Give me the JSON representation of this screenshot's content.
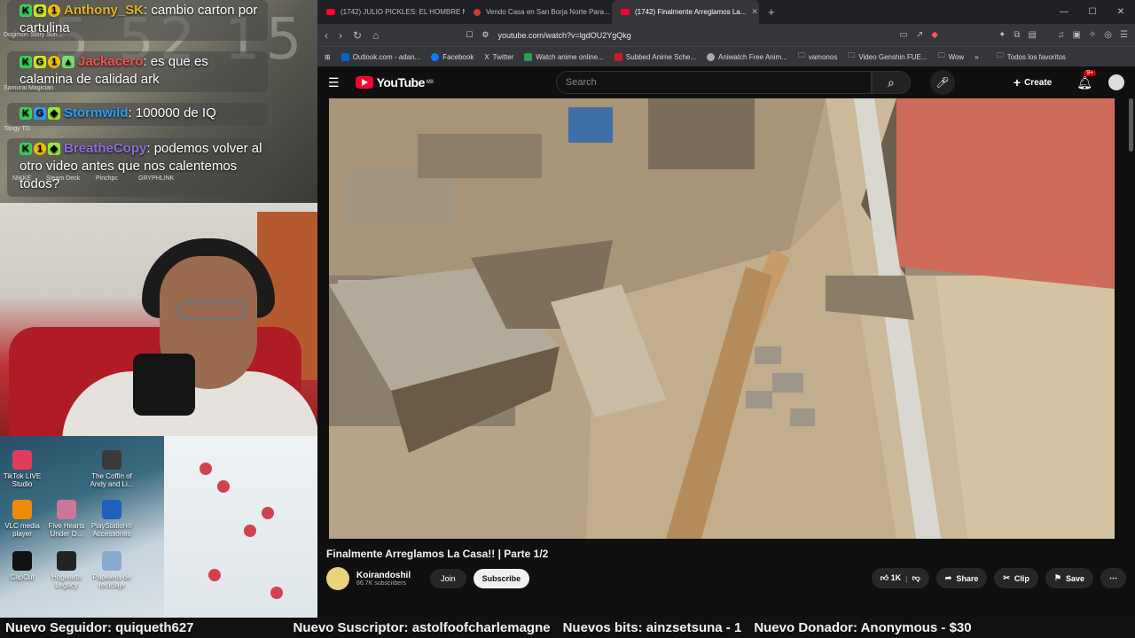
{
  "chat": {
    "clock": "5 52 15",
    "messages": [
      {
        "user": "Anthony_SK",
        "text": ": cambio carton por cartulina",
        "user_color": "#e0b321"
      },
      {
        "user": "Jackacero",
        "text": ": es que es calamina de calidad ark",
        "user_color": "#ff4d4d"
      },
      {
        "user": "Stormwild",
        "text": ": 100000 de IQ",
        "user_color": "#2a9df4"
      },
      {
        "user": "BreatheCopy",
        "text": ": podemos volver al otro video antes que nos calentemos todos?",
        "user_color": "#8f6dde"
      }
    ],
    "sub_labels": [
      "Dogimon Story Sun...",
      "Samurai Magician",
      "Tangy TD",
      "NIKKE",
      "Steam Deck",
      "Pinchpc",
      "GRYPHLINK"
    ]
  },
  "desktop_icons": [
    {
      "label": "TikTok LIVE Studio",
      "icon": "tiktok-live-icon",
      "color": "#e23b5b"
    },
    {
      "label": "The Coffin of Andy and Li...",
      "icon": "coffin-game-icon",
      "color": "#3a3a3a"
    },
    {
      "label": "VLC media player",
      "icon": "vlc-icon",
      "color": "#f08a00"
    },
    {
      "label": "Five Hearts Under O...",
      "icon": "five-hearts-icon",
      "color": "#cc7799"
    },
    {
      "label": "PlayStation® Accessories",
      "icon": "playstation-icon",
      "color": "#1f5fbf"
    },
    {
      "label": "CapCut",
      "icon": "capcut-icon",
      "color": "#111111"
    },
    {
      "label": "Hogwarts Legacy",
      "icon": "hogwarts-icon",
      "color": "#222222"
    },
    {
      "label": "Papelera de reciclaje",
      "icon": "recycle-bin-icon",
      "color": "#88aacc"
    }
  ],
  "browser": {
    "tabs": [
      {
        "title": "(1742) JULIO PICKLES: EL HOMBRE M...",
        "active": false
      },
      {
        "title": "Vendo Casa en San Borja Norte Para...",
        "active": false
      },
      {
        "title": "(1742) Finalmente Arreglamos La...",
        "active": true
      }
    ],
    "new_tab": "+",
    "url": "youtube.com/watch?v=lgdOU2YgQkg",
    "bookmarks": [
      {
        "label": "Outlook.com - adan...",
        "color": "#0a64c8"
      },
      {
        "label": "Facebook",
        "color": "#1877f2"
      },
      {
        "label": "Twitter",
        "color": "#222222"
      },
      {
        "label": "Watch anime online...",
        "color": "#2e9e4f"
      },
      {
        "label": "Subbed Anime Sche...",
        "color": "#c81e2a"
      },
      {
        "label": "Aniwatch Free Anim...",
        "color": "#aaaaaa"
      },
      {
        "label": "vamonos",
        "color": "#cccccc"
      },
      {
        "label": "Video Genshin FUE...",
        "color": "#cccccc"
      },
      {
        "label": "Wow",
        "color": "#cccccc"
      }
    ],
    "bookmarks_more": "»",
    "bookmarks_all": "Todos los favoritos"
  },
  "youtube": {
    "logo": "YouTube",
    "country": "MX",
    "search_placeholder": "Search",
    "create": "Create",
    "notifications": "9+",
    "video_title": "Finalmente Arreglamos La Casa!! | Parte 1/2",
    "channel": "Koirandoshil",
    "subscribers": "66.7K subscribers",
    "join": "Join",
    "subscribe": "Subscribe",
    "likes": "1K",
    "share": "Share",
    "clip": "Clip",
    "save": "Save"
  },
  "ticker": {
    "follower": "Nuevo Seguidor: quiqueth627",
    "subscriber": "Nuevo Suscriptor: astolfoofcharlemagne",
    "bits": "Nuevos bits: ainzsetsuna - 1",
    "donor": "Nuevo Donador: Anonymous - $30"
  }
}
